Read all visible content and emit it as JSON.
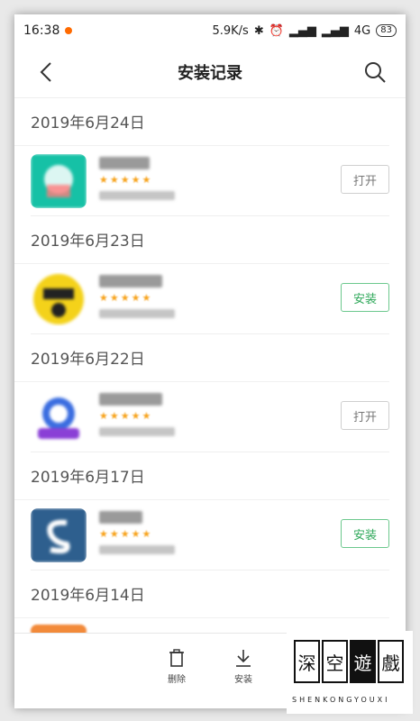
{
  "status_bar": {
    "time": "16:38",
    "network_speed": "5.9K/s",
    "signal_text": "4G",
    "battery": "83"
  },
  "nav": {
    "title": "安装记录"
  },
  "sections": [
    {
      "date": "2019年6月24日",
      "action": "打开",
      "action_type": "open",
      "icon_color": "#16c1a6"
    },
    {
      "date": "2019年6月23日",
      "action": "安装",
      "action_type": "install",
      "icon_color": "#f4d21a"
    },
    {
      "date": "2019年6月22日",
      "action": "打开",
      "action_type": "open",
      "icon_color": "#3a6de0"
    },
    {
      "date": "2019年6月17日",
      "action": "安装",
      "action_type": "install",
      "icon_color": "#2e5f8e"
    },
    {
      "date": "2019年6月14日"
    }
  ],
  "bottom_bar": {
    "delete_label": "删除",
    "install_label": "安装"
  },
  "watermark": {
    "chars": [
      "深",
      "空",
      "遊",
      "戲"
    ],
    "text": "SHENKONGYOUXI"
  },
  "colors": {
    "install_green": "#2fa85a",
    "star_orange": "#f7a21a"
  }
}
